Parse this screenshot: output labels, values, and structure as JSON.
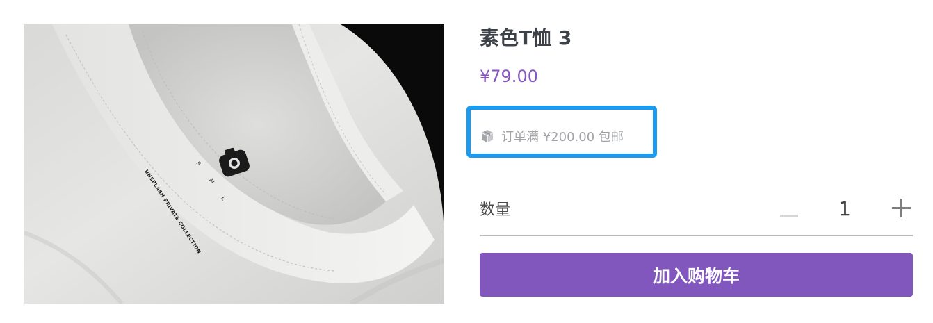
{
  "product": {
    "title": "素色T恤 3",
    "price": "¥79.00",
    "image": {
      "tag_brand": "UNSPLASH PRIVATE COLLECTION",
      "tag_sizes": [
        "S",
        "M",
        "L"
      ]
    }
  },
  "shipping": {
    "icon": "box-icon",
    "text": "订单满 ¥200.00 包邮",
    "highlight_color": "#1a9bf0"
  },
  "quantity": {
    "label": "数量",
    "value": "1",
    "minus_icon": "minus-icon",
    "plus_icon": "plus-icon"
  },
  "cart": {
    "button_label": "加入购物车",
    "button_color": "#8157bd"
  },
  "colors": {
    "accent": "#8856c0",
    "muted_text": "#a1a3a7",
    "title_text": "#3d4148"
  }
}
